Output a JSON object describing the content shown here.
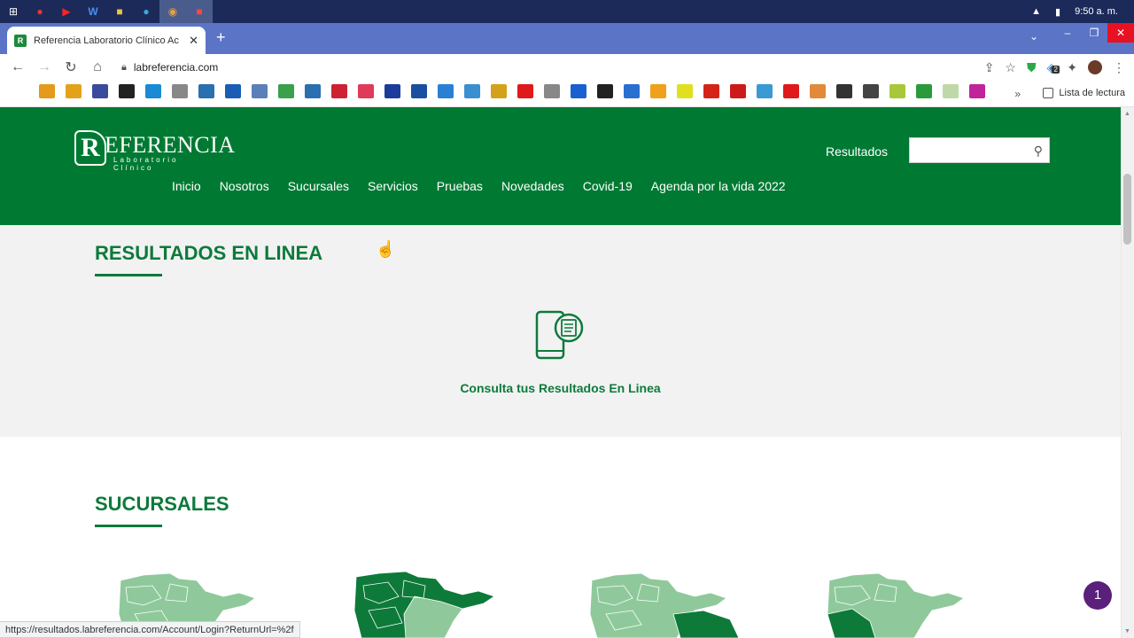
{
  "taskbar": {
    "clock": "9:50 a. m.",
    "icons": [
      "windows-icon",
      "opera-icon",
      "youtube-icon",
      "word-icon",
      "files-icon",
      "telegram-icon",
      "chrome-icon",
      "app-icon"
    ]
  },
  "browser": {
    "tab_title": "Referencia Laboratorio Clínico Ac",
    "url": "labreferencia.com",
    "extension_badge": "2",
    "reading_list": "Lista de lectura",
    "bookmark_colors": [
      "#e49a1a",
      "#e4a21a",
      "#3b4a9a",
      "#222222",
      "#1a8ad4",
      "#888888",
      "#2a6fb0",
      "#1b5db5",
      "#5b7fb8",
      "#3aa04a",
      "#2a6fb0",
      "#cc2233",
      "#e03a5a",
      "#1b3c9a",
      "#1a4fa0",
      "#2a7fd4",
      "#3a8fd0",
      "#d4a21a",
      "#e01a1a",
      "#888888",
      "#1a5fd0",
      "#222222",
      "#2a6fd0",
      "#f0a01a",
      "#e0e020",
      "#d4241a",
      "#cc1a1a",
      "#3a9ad4",
      "#e01a1a",
      "#e08a3a",
      "#333333",
      "#444444",
      "#a8c83a",
      "#2a9a3a",
      "#c0d8a8",
      "#c0249a"
    ]
  },
  "site": {
    "logo_text": "REFERENCIA",
    "logo_sub": "Laboratorio Clínico",
    "header_results": "Resultados",
    "nav": [
      "Inicio",
      "Nosotros",
      "Sucursales",
      "Servicios",
      "Pruebas",
      "Novedades",
      "Covid-19",
      "Agenda por la vida 2022"
    ],
    "section1_title": "RESULTADOS EN LINEA",
    "consulta_link": "Consulta tus Resultados En Linea",
    "section2_title": "SUCURSALES",
    "chat_count": "1",
    "brand_green": "#007a33"
  },
  "status_bar": {
    "url": "https://resultados.labreferencia.com/Account/Login?ReturnUrl=%2f"
  }
}
